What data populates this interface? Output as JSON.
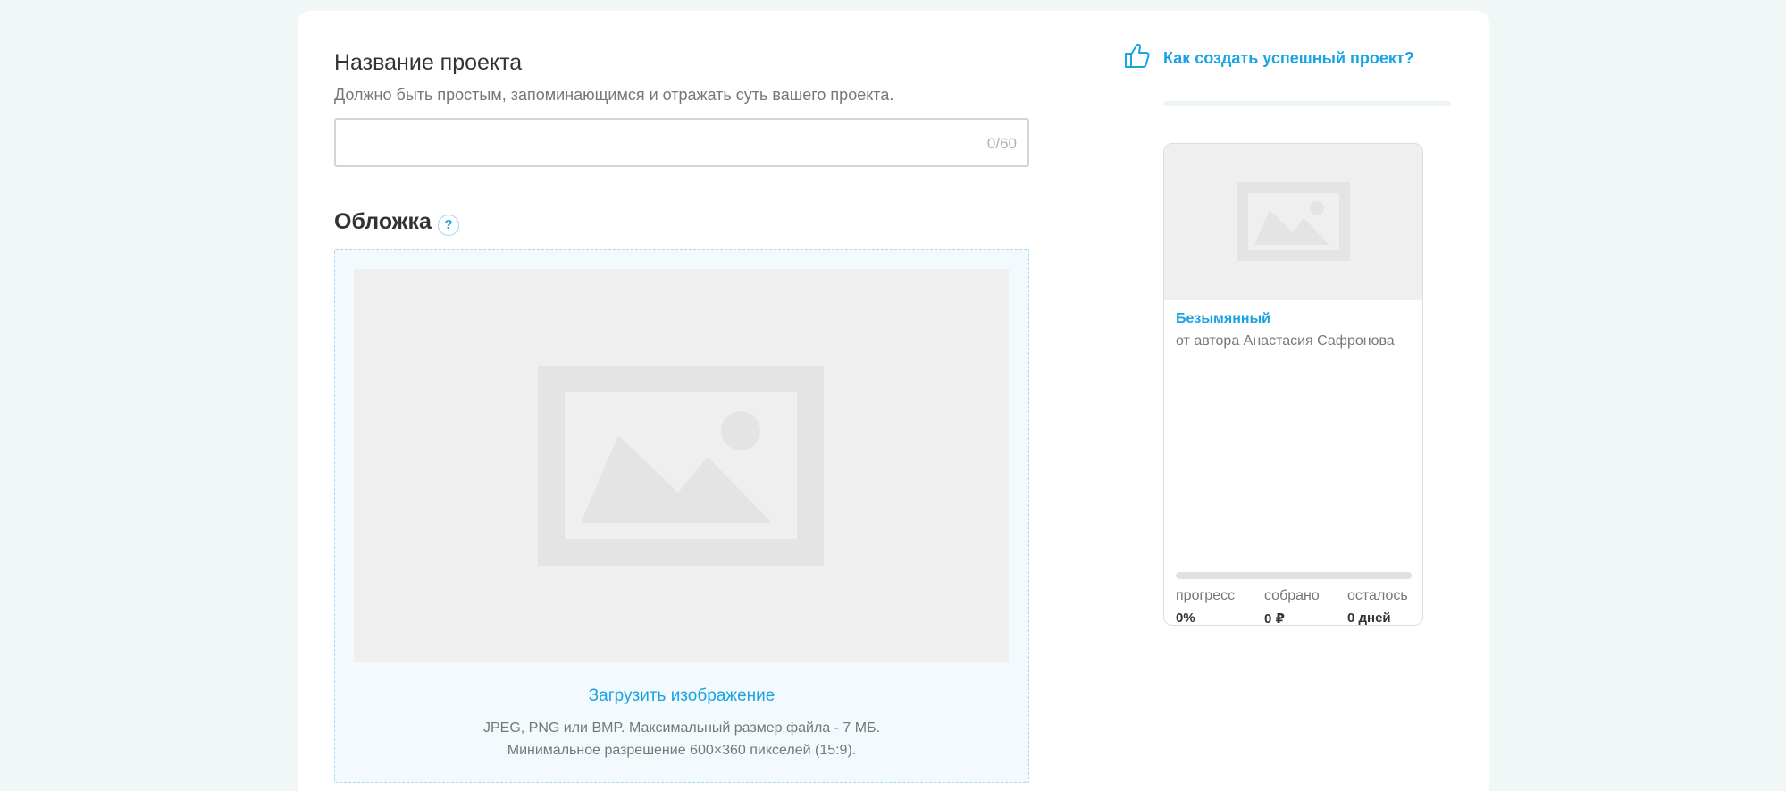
{
  "form": {
    "name_title": "Название проекта",
    "name_hint": "Должно быть простым, запоминающимся и отражать суть вашего проекта.",
    "name_value": "",
    "name_counter": "0/60",
    "cover_title": "Обложка",
    "help_symbol": "?",
    "upload_link": "Загрузить изображение",
    "upload_note_1": "JPEG, PNG или BMP. Максимальный размер файла - 7 МБ.",
    "upload_note_2": "Минимальное разрешение 600×360 пикселей (15:9)."
  },
  "sidebar": {
    "tip_link": "Как создать успешный проект?",
    "tip_icon": "thumbs-up-icon"
  },
  "preview_card": {
    "project_name": "Безымянный",
    "author": "от автора Анастасия Сафронова",
    "progress_fraction": 0,
    "stats": [
      {
        "label": "прогресс",
        "value": "0%"
      },
      {
        "label": "собрано",
        "value": "0 ₽"
      },
      {
        "label": "осталось",
        "value": "0 дней"
      }
    ]
  },
  "colors": {
    "accent": "#1aa3e3",
    "page_bg": "#f1f7f7",
    "placeholder_bg": "#efefef",
    "placeholder_shape": "#e4e4e4"
  }
}
